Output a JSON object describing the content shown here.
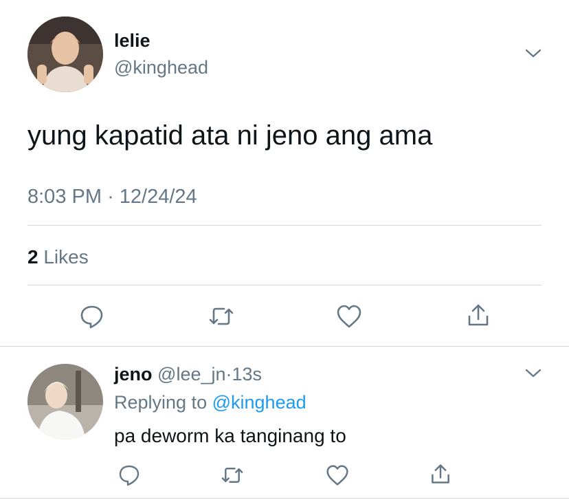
{
  "tweet": {
    "display_name": "lelie",
    "handle": "@kinghead",
    "text": "yung kapatid ata ni jeno ang ama",
    "time": "8:03 PM",
    "separator": "·",
    "date": "12/24/24",
    "likes_count": "2",
    "likes_label": "Likes"
  },
  "reply": {
    "display_name": "jeno",
    "handle": "@lee_jn",
    "dot": "·",
    "age": "13s",
    "replying_prefix": "Replying to",
    "replying_to": "@kinghead",
    "text": "pa deworm ka tanginang to"
  },
  "colors": {
    "text": "#0f1419",
    "muted": "#657786",
    "link": "#1d9bf0",
    "divider": "#cfd9de"
  }
}
